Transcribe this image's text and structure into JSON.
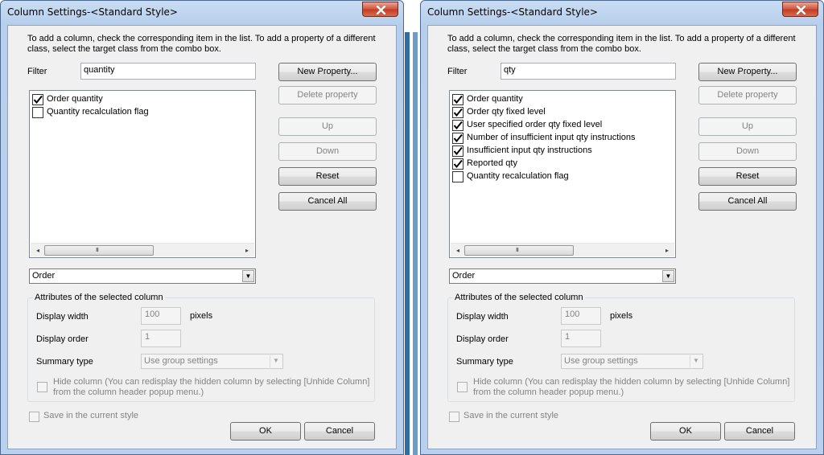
{
  "dialogs": [
    {
      "title": "Column Settings-<Standard Style>",
      "description": "To add a column, check the corresponding item in the list. To add a property of a different class, select the target class from the combo box.",
      "filter_label": "Filter",
      "filter_value": "quantity",
      "buttons": {
        "new_property": "New Property...",
        "delete_property": "Delete property",
        "up": "Up",
        "down": "Down",
        "reset": "Reset",
        "cancel_all": "Cancel All",
        "ok": "OK",
        "cancel": "Cancel"
      },
      "items": [
        {
          "label": "Order quantity",
          "checked": true
        },
        {
          "label": "Quantity recalculation flag",
          "checked": false
        }
      ],
      "class_combo": "Order",
      "attributes": {
        "group_label": "Attributes of the selected column",
        "display_width_label": "Display width",
        "display_width_value": "100",
        "pixels_label": "pixels",
        "display_order_label": "Display order",
        "display_order_value": "1",
        "summary_type_label": "Summary type",
        "summary_type_value": "Use group settings",
        "hide_column_line1": "Hide column (You can redisplay the hidden column by selecting [Unhide Column]",
        "hide_column_line2": "from the column header popup menu.)"
      },
      "save_style_label": "Save in the current style"
    },
    {
      "title": "Column Settings-<Standard Style>",
      "description": "To add a column, check the corresponding item in the list. To add a property of a different class, select the target class from the combo box.",
      "filter_label": "Filter",
      "filter_value": "qty",
      "buttons": {
        "new_property": "New Property...",
        "delete_property": "Delete property",
        "up": "Up",
        "down": "Down",
        "reset": "Reset",
        "cancel_all": "Cancel All",
        "ok": "OK",
        "cancel": "Cancel"
      },
      "items": [
        {
          "label": "Order quantity",
          "checked": true
        },
        {
          "label": "Order qty fixed level",
          "checked": true
        },
        {
          "label": "User specified order qty fixed level",
          "checked": true
        },
        {
          "label": "Number of insufficient input qty instructions",
          "checked": true
        },
        {
          "label": "Insufficient input qty instructions",
          "checked": true
        },
        {
          "label": "Reported qty",
          "checked": true
        },
        {
          "label": "Quantity recalculation flag",
          "checked": false
        }
      ],
      "class_combo": "Order",
      "attributes": {
        "group_label": "Attributes of the selected column",
        "display_width_label": "Display width",
        "display_width_value": "100",
        "pixels_label": "pixels",
        "display_order_label": "Display order",
        "display_order_value": "1",
        "summary_type_label": "Summary type",
        "summary_type_value": "Use group settings",
        "hide_column_line1": "Hide column (You can redisplay the hidden column by selecting [Unhide Column]",
        "hide_column_line2": "from the column header popup menu.)"
      },
      "save_style_label": "Save in the current style"
    }
  ]
}
